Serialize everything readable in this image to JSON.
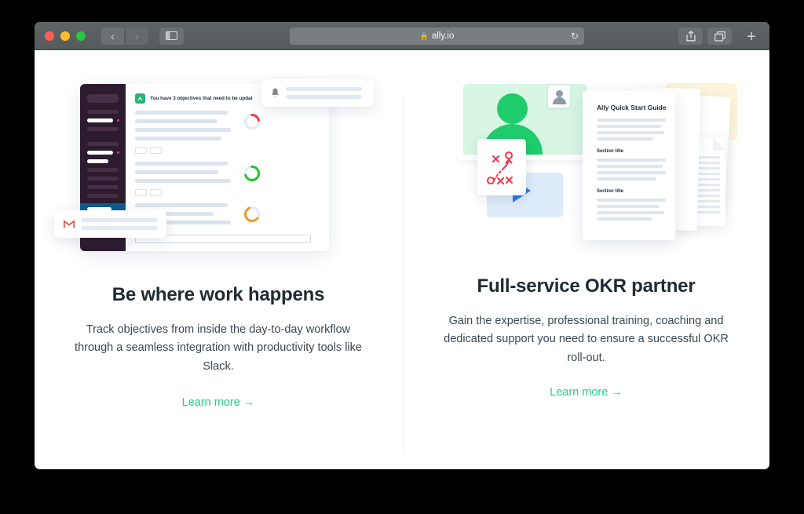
{
  "browser": {
    "traffic_lights": [
      "close",
      "minimize",
      "zoom"
    ],
    "back_label": "‹",
    "forward_label": "›",
    "sidebar_icon": "sidebar-icon",
    "url": "ally.io",
    "lock_icon": "lock-icon",
    "reload_icon": "↻",
    "share_icon": "share-icon",
    "tabs_icon": "tabs-icon",
    "new_tab_label": "+"
  },
  "page": {
    "columns": [
      {
        "id": "be-where-work-happens",
        "headline": "Be where work happens",
        "body": "Track objectives from inside the day-to-day workflow through a seamless integration with productivity tools like Slack.",
        "link": "Learn more →",
        "illustration": {
          "type": "slack-integration-app",
          "notification_text": "You have 3 objectives that need to be updat",
          "app_icon": "slack-icon",
          "bell_card_icon": "bell-icon",
          "gmail_card_icon": "gmail-icon",
          "progress_rings": [
            {
              "color": "#ef3e4a",
              "percent": 22
            },
            {
              "color": "#22c32f",
              "percent": 70
            },
            {
              "color": "#f59a2e",
              "percent": 58
            }
          ],
          "sidebar_color": "#2d1b2e",
          "sidebar_active_color": "#0f5c94",
          "badge_color": "#e8424e"
        }
      },
      {
        "id": "full-service-okr-partner",
        "headline": "Full-service OKR partner",
        "body": "Gain the expertise, professional training, coaching and dedicated support you need to ensure a successful OKR roll-out.",
        "link": "Learn more →",
        "illustration": {
          "type": "okr-services-collage",
          "doc_title": "Ally Quick Start Guide",
          "doc_sections": [
            "Section title",
            "Section title"
          ],
          "video_card_icon": "person-silhouette-icon",
          "avatar_icon": "avatar-icon",
          "play_icon": "play-icon",
          "strategy_icon": "strategy-playbook-icon",
          "yellow_card_icon": "card-outline-icon",
          "green_color": "#1fcc6b",
          "green_bg_color": "#d7f6e3",
          "blue_color": "#2a7ce8",
          "blue_bg_color": "#deebfa",
          "yellow_color": "#fbbe2e",
          "yellow_bg_color": "#fdf5d9",
          "strategy_mark_color": "#f7384f"
        }
      }
    ],
    "accent_color": "#1fd18a",
    "divider_color": "#eceef2"
  }
}
